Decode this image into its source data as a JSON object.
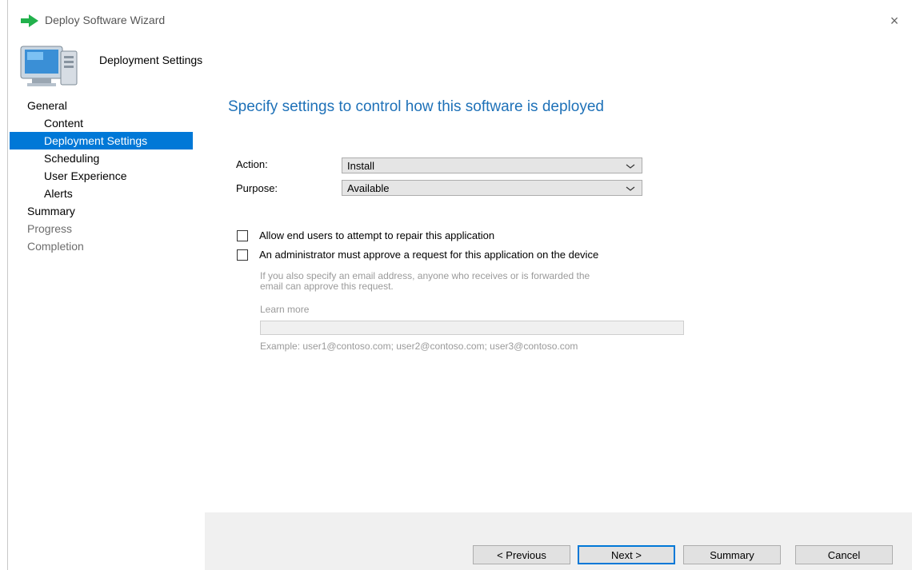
{
  "window": {
    "title": "Deploy Software Wizard",
    "close_glyph": "×",
    "app_icon": "green-arrow-icon"
  },
  "header": {
    "icon": "computer-icon",
    "title": "Deployment Settings"
  },
  "sidebar": {
    "items": [
      {
        "label": "General",
        "level": 1,
        "state": "normal"
      },
      {
        "label": "Content",
        "level": 2,
        "state": "normal"
      },
      {
        "label": "Deployment Settings",
        "level": 2,
        "state": "selected"
      },
      {
        "label": "Scheduling",
        "level": 2,
        "state": "normal"
      },
      {
        "label": "User Experience",
        "level": 2,
        "state": "normal"
      },
      {
        "label": "Alerts",
        "level": 2,
        "state": "normal"
      },
      {
        "label": "Summary",
        "level": 1,
        "state": "normal"
      },
      {
        "label": "Progress",
        "level": 1,
        "state": "disabled"
      },
      {
        "label": "Completion",
        "level": 1,
        "state": "disabled"
      }
    ]
  },
  "main": {
    "heading": "Specify settings to control how this software is deployed",
    "action": {
      "label": "Action:",
      "value": "Install"
    },
    "purpose": {
      "label": "Purpose:",
      "value": "Available"
    },
    "repair_checkbox": {
      "label": "Allow end users to attempt to repair this application",
      "checked": false
    },
    "approve_checkbox": {
      "label": "An administrator must approve a request for this application on the device",
      "checked": false
    },
    "approval_note_line1": "If you also specify an email address, anyone who receives or is forwarded the",
    "approval_note_line2": "email can approve this request.",
    "learn_more": "Learn more",
    "email_value": "",
    "email_example": "Example: user1@contoso.com; user2@contoso.com; user3@contoso.com"
  },
  "footer": {
    "previous": "< Previous",
    "next": "Next >",
    "summary": "Summary",
    "cancel": "Cancel"
  },
  "colors": {
    "accent": "#0078d7",
    "heading": "#1e71b8",
    "disabled_text": "#9a9a9a"
  }
}
